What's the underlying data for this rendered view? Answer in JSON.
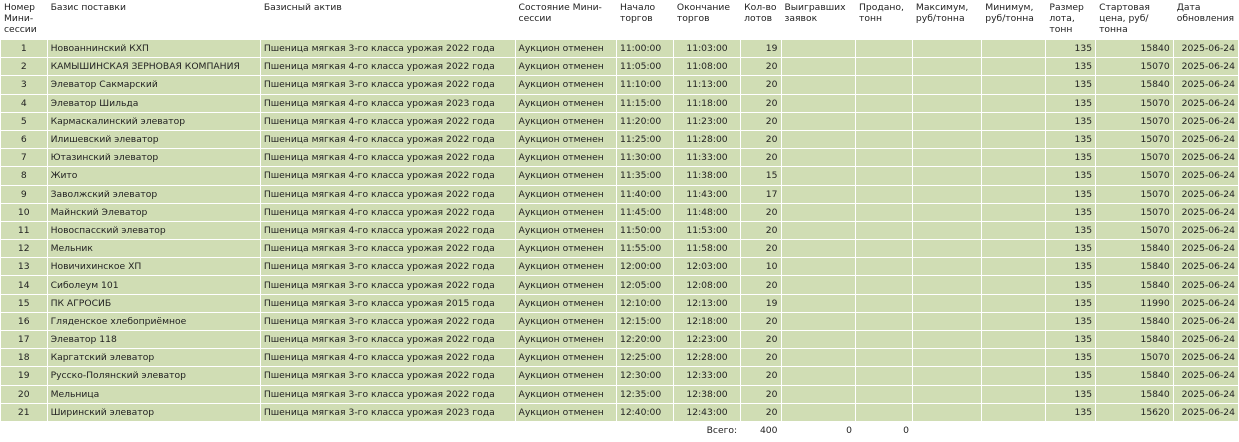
{
  "columns": [
    "Номер Мини-сессии",
    "Базис поставки",
    "Базисный актив",
    "Состояние Мини-сессии",
    "Начало торгов",
    "Окончание торгов",
    "Кол-во лотов",
    "Выигравших заявок",
    "Продано, тонн",
    "Максимум, руб/тонна",
    "Минимум, руб/тонна",
    "Размер лота, тонн",
    "Стартовая цена, руб/тонна",
    "Дата обновления"
  ],
  "rows": [
    {
      "num": "1",
      "basis": "Новоаннинский КХП",
      "asset": "Пшеница мягкая 3-го класса урожая 2022 года",
      "state": "Аукцион отменен",
      "start": "11:00:00",
      "end": "11:03:00",
      "lots": "19",
      "won": "",
      "sold": "",
      "max": "",
      "min": "",
      "lot_size": "135",
      "price": "15840",
      "date": "2025-06-24"
    },
    {
      "num": "2",
      "basis": "КАМЫШИНСКАЯ ЗЕРНОВАЯ КОМПАНИЯ",
      "asset": "Пшеница мягкая 4-го класса урожая 2022 года",
      "state": "Аукцион отменен",
      "start": "11:05:00",
      "end": "11:08:00",
      "lots": "20",
      "won": "",
      "sold": "",
      "max": "",
      "min": "",
      "lot_size": "135",
      "price": "15070",
      "date": "2025-06-24"
    },
    {
      "num": "3",
      "basis": "Элеватор Сакмарский",
      "asset": "Пшеница мягкая 3-го класса урожая 2022 года",
      "state": "Аукцион отменен",
      "start": "11:10:00",
      "end": "11:13:00",
      "lots": "20",
      "won": "",
      "sold": "",
      "max": "",
      "min": "",
      "lot_size": "135",
      "price": "15840",
      "date": "2025-06-24"
    },
    {
      "num": "4",
      "basis": "Элеватор Шильда",
      "asset": "Пшеница мягкая 4-го класса урожая 2023 года",
      "state": "Аукцион отменен",
      "start": "11:15:00",
      "end": "11:18:00",
      "lots": "20",
      "won": "",
      "sold": "",
      "max": "",
      "min": "",
      "lot_size": "135",
      "price": "15070",
      "date": "2025-06-24"
    },
    {
      "num": "5",
      "basis": "Кармаскалинский элеватор",
      "asset": "Пшеница мягкая 4-го класса урожая 2022 года",
      "state": "Аукцион отменен",
      "start": "11:20:00",
      "end": "11:23:00",
      "lots": "20",
      "won": "",
      "sold": "",
      "max": "",
      "min": "",
      "lot_size": "135",
      "price": "15070",
      "date": "2025-06-24"
    },
    {
      "num": "6",
      "basis": "Илишевский элеватор",
      "asset": "Пшеница мягкая 4-го класса урожая 2022 года",
      "state": "Аукцион отменен",
      "start": "11:25:00",
      "end": "11:28:00",
      "lots": "20",
      "won": "",
      "sold": "",
      "max": "",
      "min": "",
      "lot_size": "135",
      "price": "15070",
      "date": "2025-06-24"
    },
    {
      "num": "7",
      "basis": "Ютазинский элеватор",
      "asset": "Пшеница мягкая 4-го класса урожая 2022 года",
      "state": "Аукцион отменен",
      "start": "11:30:00",
      "end": "11:33:00",
      "lots": "20",
      "won": "",
      "sold": "",
      "max": "",
      "min": "",
      "lot_size": "135",
      "price": "15070",
      "date": "2025-06-24"
    },
    {
      "num": "8",
      "basis": "Жито",
      "asset": "Пшеница мягкая 4-го класса урожая 2022 года",
      "state": "Аукцион отменен",
      "start": "11:35:00",
      "end": "11:38:00",
      "lots": "15",
      "won": "",
      "sold": "",
      "max": "",
      "min": "",
      "lot_size": "135",
      "price": "15070",
      "date": "2025-06-24"
    },
    {
      "num": "9",
      "basis": "Заволжский элеватор",
      "asset": "Пшеница мягкая 4-го класса урожая 2022 года",
      "state": "Аукцион отменен",
      "start": "11:40:00",
      "end": "11:43:00",
      "lots": "17",
      "won": "",
      "sold": "",
      "max": "",
      "min": "",
      "lot_size": "135",
      "price": "15070",
      "date": "2025-06-24"
    },
    {
      "num": "10",
      "basis": "Майнский Элеватор",
      "asset": "Пшеница мягкая 4-го класса урожая 2022 года",
      "state": "Аукцион отменен",
      "start": "11:45:00",
      "end": "11:48:00",
      "lots": "20",
      "won": "",
      "sold": "",
      "max": "",
      "min": "",
      "lot_size": "135",
      "price": "15070",
      "date": "2025-06-24"
    },
    {
      "num": "11",
      "basis": "Новоспасский элеватор",
      "asset": "Пшеница мягкая 4-го класса урожая 2022 года",
      "state": "Аукцион отменен",
      "start": "11:50:00",
      "end": "11:53:00",
      "lots": "20",
      "won": "",
      "sold": "",
      "max": "",
      "min": "",
      "lot_size": "135",
      "price": "15070",
      "date": "2025-06-24"
    },
    {
      "num": "12",
      "basis": "Мельник",
      "asset": "Пшеница мягкая 3-го класса урожая 2022 года",
      "state": "Аукцион отменен",
      "start": "11:55:00",
      "end": "11:58:00",
      "lots": "20",
      "won": "",
      "sold": "",
      "max": "",
      "min": "",
      "lot_size": "135",
      "price": "15840",
      "date": "2025-06-24"
    },
    {
      "num": "13",
      "basis": "Новичихинское ХП",
      "asset": "Пшеница мягкая 3-го класса урожая 2022 года",
      "state": "Аукцион отменен",
      "start": "12:00:00",
      "end": "12:03:00",
      "lots": "10",
      "won": "",
      "sold": "",
      "max": "",
      "min": "",
      "lot_size": "135",
      "price": "15840",
      "date": "2025-06-24"
    },
    {
      "num": "14",
      "basis": "Сиболеум 101",
      "asset": "Пшеница мягкая 3-го класса урожая 2022 года",
      "state": "Аукцион отменен",
      "start": "12:05:00",
      "end": "12:08:00",
      "lots": "20",
      "won": "",
      "sold": "",
      "max": "",
      "min": "",
      "lot_size": "135",
      "price": "15840",
      "date": "2025-06-24"
    },
    {
      "num": "15",
      "basis": "ПК АГРОСИБ",
      "asset": "Пшеница мягкая 3-го класса урожая 2015 года",
      "state": "Аукцион отменен",
      "start": "12:10:00",
      "end": "12:13:00",
      "lots": "19",
      "won": "",
      "sold": "",
      "max": "",
      "min": "",
      "lot_size": "135",
      "price": "11990",
      "date": "2025-06-24"
    },
    {
      "num": "16",
      "basis": "Гляденское хлебоприёмное",
      "asset": "Пшеница мягкая 3-го класса урожая 2022 года",
      "state": "Аукцион отменен",
      "start": "12:15:00",
      "end": "12:18:00",
      "lots": "20",
      "won": "",
      "sold": "",
      "max": "",
      "min": "",
      "lot_size": "135",
      "price": "15840",
      "date": "2025-06-24"
    },
    {
      "num": "17",
      "basis": "Элеватор 118",
      "asset": "Пшеница мягкая 3-го класса урожая 2022 года",
      "state": "Аукцион отменен",
      "start": "12:20:00",
      "end": "12:23:00",
      "lots": "20",
      "won": "",
      "sold": "",
      "max": "",
      "min": "",
      "lot_size": "135",
      "price": "15840",
      "date": "2025-06-24"
    },
    {
      "num": "18",
      "basis": "Каргатский элеватор",
      "asset": "Пшеница мягкая 4-го класса урожая 2022 года",
      "state": "Аукцион отменен",
      "start": "12:25:00",
      "end": "12:28:00",
      "lots": "20",
      "won": "",
      "sold": "",
      "max": "",
      "min": "",
      "lot_size": "135",
      "price": "15070",
      "date": "2025-06-24"
    },
    {
      "num": "19",
      "basis": "Русско-Полянский элеватор",
      "asset": "Пшеница мягкая 3-го класса урожая 2022 года",
      "state": "Аукцион отменен",
      "start": "12:30:00",
      "end": "12:33:00",
      "lots": "20",
      "won": "",
      "sold": "",
      "max": "",
      "min": "",
      "lot_size": "135",
      "price": "15840",
      "date": "2025-06-24"
    },
    {
      "num": "20",
      "basis": "Мельница",
      "asset": "Пшеница мягкая 3-го класса урожая 2022 года",
      "state": "Аукцион отменен",
      "start": "12:35:00",
      "end": "12:38:00",
      "lots": "20",
      "won": "",
      "sold": "",
      "max": "",
      "min": "",
      "lot_size": "135",
      "price": "15840",
      "date": "2025-06-24"
    },
    {
      "num": "21",
      "basis": "Ширинский элеватор",
      "asset": "Пшеница мягкая 3-го класса урожая 2023 года",
      "state": "Аукцион отменен",
      "start": "12:40:00",
      "end": "12:43:00",
      "lots": "20",
      "won": "",
      "sold": "",
      "max": "",
      "min": "",
      "lot_size": "135",
      "price": "15620",
      "date": "2025-06-24"
    }
  ],
  "totals": {
    "label": "Всего:",
    "lots": "400",
    "won": "0",
    "sold": "0"
  },
  "colors": {
    "row_background": "#d0ddb4",
    "page_background": "#ffffff",
    "text": "#222222"
  }
}
